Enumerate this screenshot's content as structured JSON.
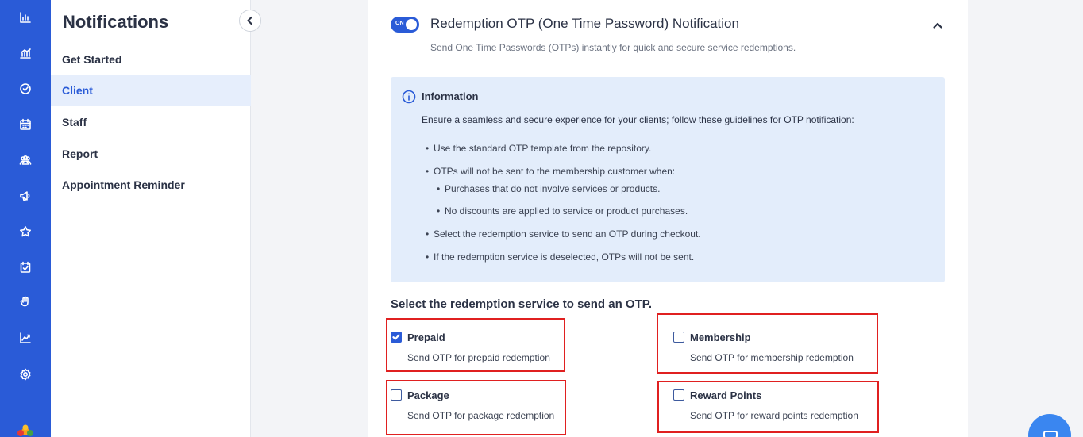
{
  "rail": {
    "icons": [
      "dashboard-icon",
      "bar-chart-icon",
      "check-circle-icon",
      "calendar-icon",
      "users-icon",
      "megaphone-icon",
      "star-icon",
      "calendar-check-icon",
      "hand-icon",
      "trend-icon",
      "settings-icon"
    ]
  },
  "sidebar": {
    "title": "Notifications",
    "items": [
      {
        "label": "Get Started"
      },
      {
        "label": "Client"
      },
      {
        "label": "Staff"
      },
      {
        "label": "Report"
      },
      {
        "label": "Appointment Reminder"
      }
    ],
    "active_index": 1
  },
  "main": {
    "toggle_label": "ON",
    "toggle_state": true,
    "title": "Redemption OTP (One Time Password) Notification",
    "subtitle": "Send One Time Passwords (OTPs) instantly for quick and secure service redemptions.",
    "info": {
      "title": "Information",
      "description": "Ensure a seamless and secure experience for your clients; follow these guidelines for OTP notification:",
      "bullets": [
        "Use the standard OTP template from the repository.",
        "OTPs will not be sent to the membership customer when:",
        "Purchases that do not involve services or products.",
        "No discounts are applied to service or product purchases.",
        "Select the redemption service to send an OTP during checkout.",
        "If the redemption service is deselected, OTPs will not be sent."
      ]
    },
    "select_title": "Select the redemption service to send an OTP.",
    "options": [
      {
        "label": "Prepaid",
        "description": "Send OTP for prepaid redemption",
        "checked": true
      },
      {
        "label": "Membership",
        "description": "Send OTP for membership redemption",
        "checked": false
      },
      {
        "label": "Package",
        "description": "Send OTP for package redemption",
        "checked": false
      },
      {
        "label": "Reward Points",
        "description": "Send OTP for reward points redemption",
        "checked": false
      }
    ]
  },
  "colors": {
    "primary": "#2a5bd7",
    "info_bg": "#e3edfb",
    "highlight": "#e02020"
  }
}
